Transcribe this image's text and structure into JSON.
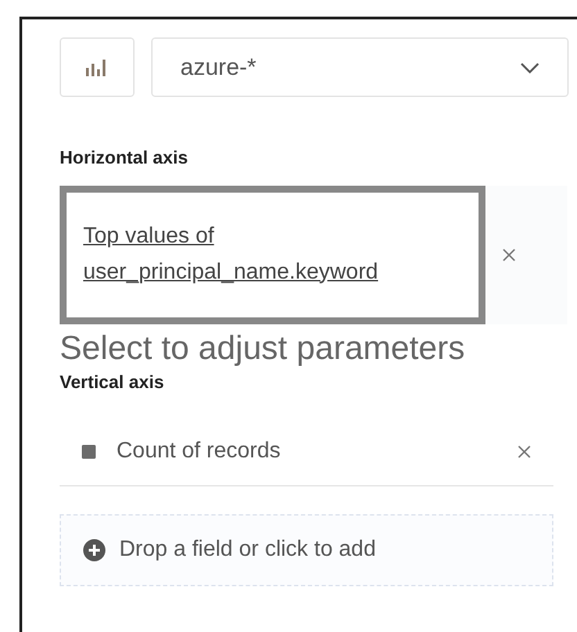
{
  "data_view": {
    "value": "azure-*"
  },
  "horizontal_axis": {
    "label": "Horizontal axis",
    "field": {
      "text_lines": [
        "Top values of",
        "user_principal_name.keyword"
      ],
      "selected": true
    }
  },
  "hint": "Select to adjust parameters",
  "vertical_axis": {
    "label": "Vertical axis",
    "field": {
      "text": "Count of records",
      "color": "#6b6b6b"
    }
  },
  "add_field": {
    "text": "Drop a field or click to add"
  }
}
